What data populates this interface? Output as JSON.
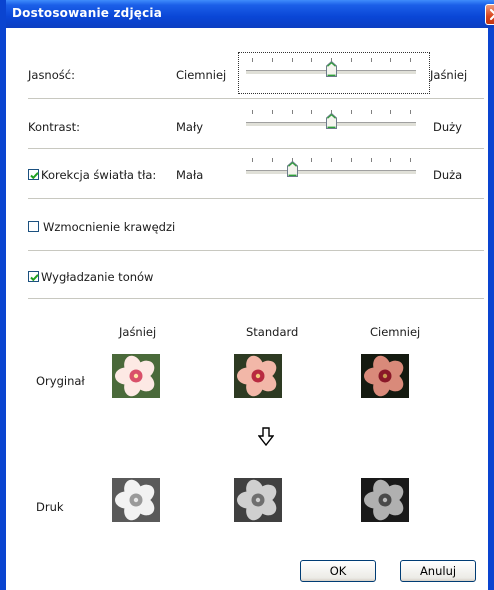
{
  "window": {
    "title": "Dostosowanie zdjęcia"
  },
  "brightness": {
    "label": "Jasność:",
    "min_label": "Ciemniej",
    "max_label": "Jaśniej",
    "value": 0.5
  },
  "contrast": {
    "label": "Kontrast:",
    "min_label": "Mały",
    "max_label": "Duży",
    "value": 0.5
  },
  "backlight": {
    "label": "Korekcja światła tła:",
    "checked": true,
    "min_label": "Mała",
    "max_label": "Duża",
    "value": 0.25
  },
  "edge": {
    "label": "Wzmocnienie krawędzi",
    "checked": false
  },
  "smoothing": {
    "label": "Wygładzanie tonów",
    "checked": true
  },
  "preview": {
    "columns": [
      "Jaśniej",
      "Standard",
      "Ciemniej"
    ],
    "row_original": "Oryginał",
    "row_print": "Druk"
  },
  "buttons": {
    "ok": "OK",
    "cancel": "Anuluj"
  },
  "colors": {
    "titlebar": "#0a46d6",
    "check": "#21a121",
    "thumb_accent": "#2e9e3a"
  },
  "icons": {
    "close": "close-icon",
    "arrow": "arrow-down-icon"
  }
}
